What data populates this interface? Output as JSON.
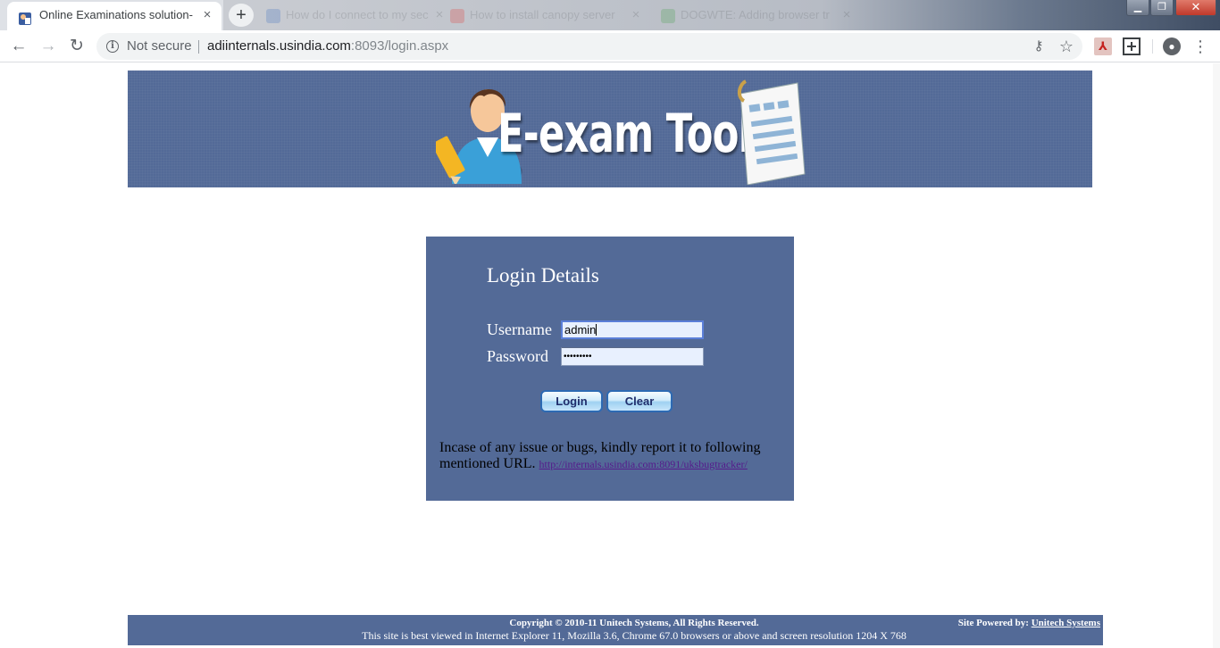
{
  "browser": {
    "active_tab": {
      "title": "Online Examinations solution-",
      "close": "×"
    },
    "background_tabs": [
      {
        "title": "How do I connect to my sec",
        "close": "×",
        "favicon_color": "#3b6fc0"
      },
      {
        "title": "How to install canopy server",
        "close": "×",
        "favicon_color": "#e53935"
      },
      {
        "title": "DOGWTE: Adding browser tr",
        "close": "×",
        "favicon_color": "#43a047"
      }
    ],
    "new_tab_label": "+",
    "window_controls": {
      "minimize": "▁",
      "maximize": "❐",
      "close": "✕"
    },
    "nav": {
      "back": "←",
      "forward": "→",
      "reload": "↻"
    },
    "omnibox": {
      "security_label": "Not secure",
      "url_host": "adiinternals.usindia.com",
      "url_rest": ":8093/login.aspx"
    },
    "icons": {
      "key": "⚷",
      "star": "☆",
      "pdf": "⅄",
      "profile": "●",
      "menu": "⋮"
    }
  },
  "page": {
    "banner": {
      "title": "E-exam Tool"
    },
    "login": {
      "title": "Login Details",
      "username_label": "Username",
      "username_value": "admin",
      "password_label": "Password",
      "password_value": "•••••••••",
      "login_button": "Login",
      "clear_button": "Clear",
      "note_text": "Incase of any issue or bugs, kindly report it to following mentioned URL.",
      "note_link": "http://internals.usindia.com:8091/uksbugtracker/"
    },
    "footer": {
      "copyright": "Copyright © 2010-11 Unitech Systems, All Rights Reserved.",
      "best_viewed": "This site is best viewed in Internet Explorer 11, Mozilla 3.6, Chrome 67.0 browsers or above and screen resolution 1204 X 768",
      "powered_label": "Site Powered by:",
      "powered_link": "Unitech Systems"
    }
  },
  "colors": {
    "banner_bg": "#536a97",
    "login_bg": "#536a97",
    "button_border": "#2d6ab3",
    "input_bg": "#e8f0fe"
  }
}
